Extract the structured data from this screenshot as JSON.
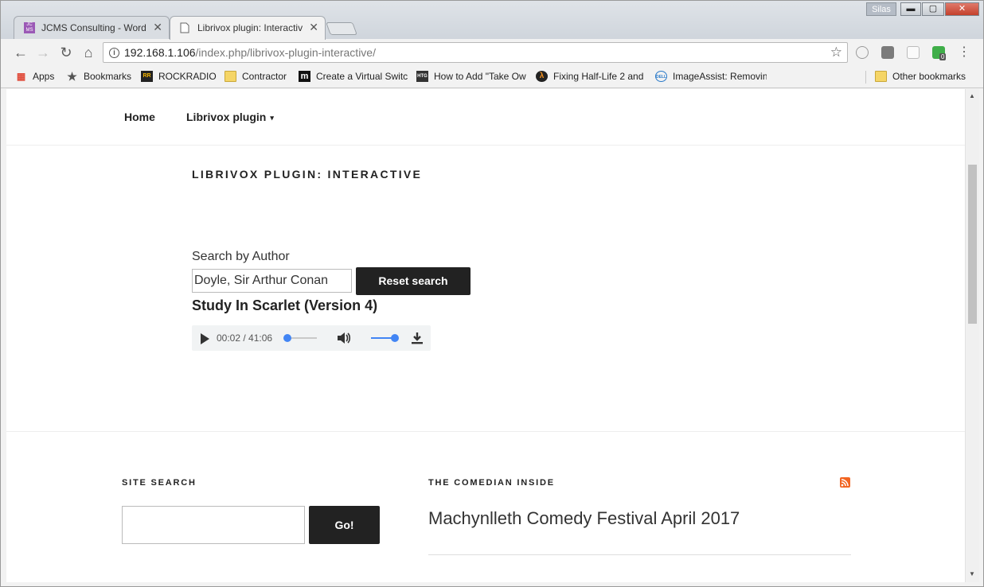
{
  "browser": {
    "tabs": [
      {
        "label": "JCMS Consulting - Word",
        "active": false
      },
      {
        "label": "Librivox plugin: Interactiv",
        "active": true
      }
    ],
    "profile_name": "Silas",
    "window_controls": {
      "minimize": "▬",
      "maximize": "▢",
      "close": "✕"
    },
    "url_host": "192.168.1.106",
    "url_path": "/index.php/librivox-plugin-interactive/",
    "bookmarks": [
      {
        "label": "Apps",
        "icon": "apps-grid-icon"
      },
      {
        "label": "Bookmarks",
        "icon": "star-icon"
      },
      {
        "label": "ROCKRADIO",
        "icon": "rockradio-icon"
      },
      {
        "label": "Contractor",
        "icon": "folder-icon"
      },
      {
        "label": "Create a Virtual Switc",
        "icon": "m-logo-icon"
      },
      {
        "label": "How to Add \"Take Ow",
        "icon": "htg-icon"
      },
      {
        "label": "Fixing Half-Life 2 and",
        "icon": "lambda-icon"
      },
      {
        "label": "ImageAssist: Removin",
        "icon": "dell-icon"
      }
    ],
    "other_bookmarks": "Other bookmarks",
    "extension_badge": "0"
  },
  "site": {
    "nav": {
      "home": "Home",
      "librivox": "Librivox plugin"
    },
    "page_title": "LIBRIVOX PLUGIN: INTERACTIVE",
    "search": {
      "label": "Search by Author",
      "author_value": "Doyle, Sir Arthur Conan",
      "reset_label": "Reset search"
    },
    "book_title": "Study In Scarlet (Version 4)",
    "audio": {
      "time": "00:02 / 41:06",
      "progress": 0.0008,
      "volume": 1.0
    },
    "footer": {
      "site_search_heading": "SITE SEARCH",
      "go_label": "Go!",
      "comedian_heading": "THE COMEDIAN INSIDE",
      "festival_link": "Machynlleth Comedy Festival April 2017"
    }
  },
  "colors": {
    "accent": "#4285f4",
    "button_dark": "#222222",
    "rss": "#f26522"
  }
}
